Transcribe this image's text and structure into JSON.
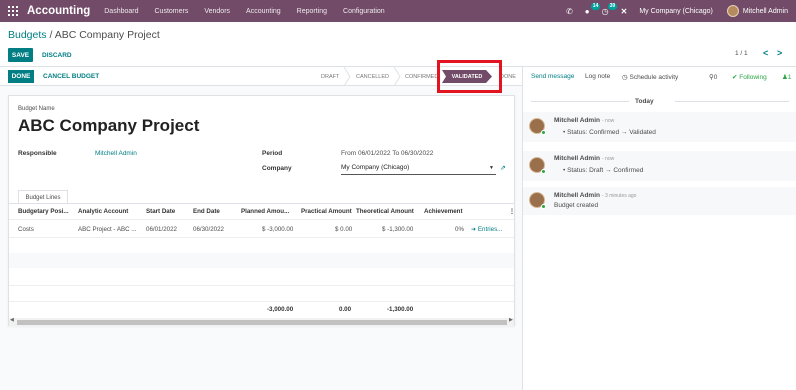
{
  "navbar": {
    "brand": "Accounting",
    "menu": [
      "Dashboard",
      "Customers",
      "Vendors",
      "Accounting",
      "Reporting",
      "Configuration"
    ],
    "messages_badge": "14",
    "activity_badge": "39",
    "company": "My Company (Chicago)",
    "user": "Mitchell Admin",
    "icons": [
      "apps-icon",
      "phone-icon",
      "chat-icon",
      "clock-icon",
      "tools-icon"
    ]
  },
  "control": {
    "breadcrumb_parent": "Budgets",
    "breadcrumb_sep": " / ",
    "breadcrumb_current": "ABC Company Project",
    "save_label": "SAVE",
    "discard_label": "DISCARD",
    "pager": "1 / 1",
    "pager_prev": "<",
    "pager_next": ">"
  },
  "statusbar": {
    "done_label": "DONE",
    "cancel_label": "CANCEL BUDGET",
    "stages": [
      "DRAFT",
      "CANCELLED",
      "CONFIRMED",
      "VALIDATED",
      "DONE"
    ],
    "active_stage": "VALIDATED"
  },
  "form": {
    "name_label": "Budget Name",
    "name": "ABC Company Project",
    "responsible_label": "Responsible",
    "responsible": "Mitchell Admin",
    "period_label": "Period",
    "period": "From 06/01/2022 To 06/30/2022",
    "company_label": "Company",
    "company": "My Company (Chicago)",
    "tab_label": "Budget Lines"
  },
  "table": {
    "headers": [
      "Budgetary Posi...",
      "Analytic Account",
      "Start Date",
      "End Date",
      "Planned Amou...",
      "Practical Amount",
      "Theoretical Amount",
      "Achievement"
    ],
    "rows": [
      {
        "budgetary": "Costs",
        "analytic": "ABC Project - ABC ...",
        "start": "06/01/2022",
        "end": "06/30/2022",
        "planned": "$ -3,000.00",
        "practical": "$ 0.00",
        "theoretical": "$ -1,300.00",
        "achievement": "0%",
        "entries": "Entries..."
      }
    ],
    "totals": {
      "planned": "-3,000.00",
      "practical": "0.00",
      "theoretical": "-1,300.00"
    }
  },
  "chatter": {
    "send_message": "Send message",
    "log_note": "Log note",
    "schedule": "Schedule activity",
    "attachments": "0",
    "following": "Following",
    "followers": "1",
    "today": "Today",
    "messages": [
      {
        "author": "Mitchell Admin",
        "time": "- now",
        "body": "Status: Confirmed → Validated",
        "bullet": true
      },
      {
        "author": "Mitchell Admin",
        "time": "- now",
        "body": "Status: Draft → Confirmed",
        "bullet": true
      },
      {
        "author": "Mitchell Admin",
        "time": "- 3 minutes ago",
        "body": "Budget created",
        "bullet": false
      }
    ]
  },
  "colors": {
    "brand": "#714b67",
    "accent": "#017e84",
    "highlight": "#e2141f"
  }
}
